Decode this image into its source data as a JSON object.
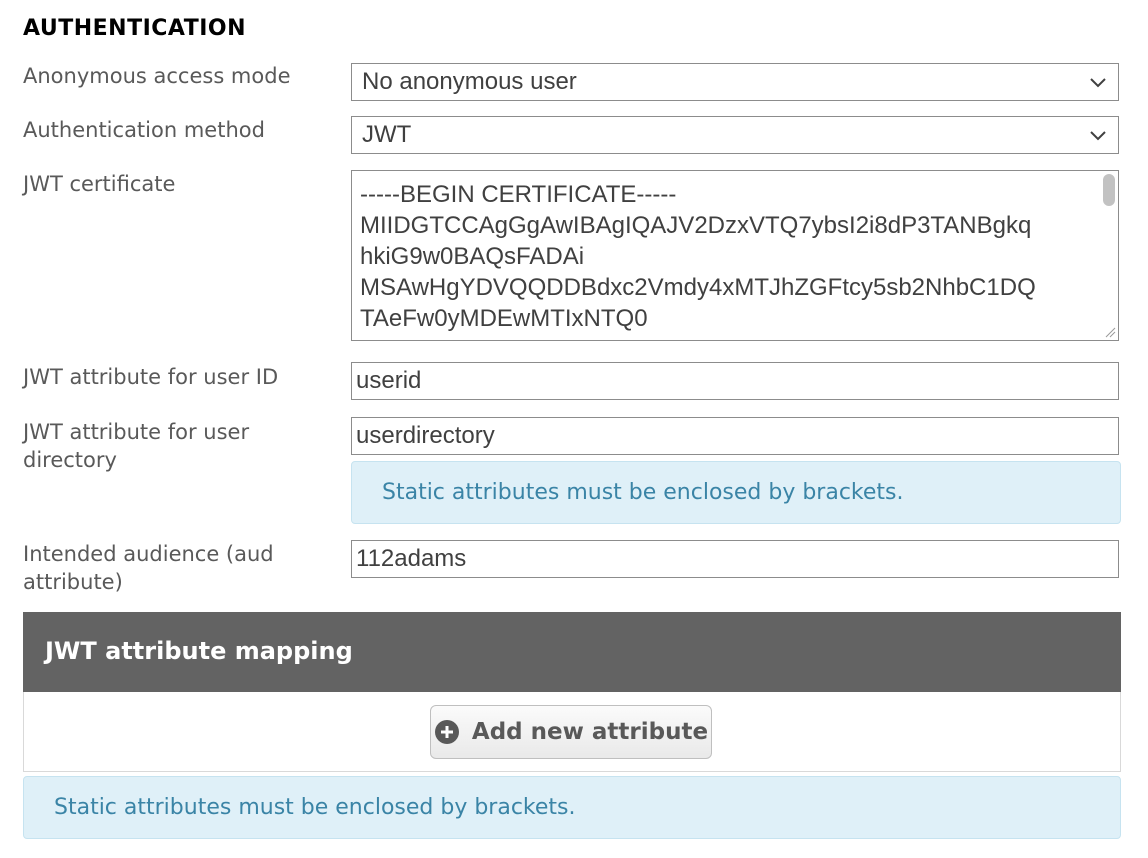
{
  "section": {
    "title": "AUTHENTICATION"
  },
  "anonymous_access": {
    "label": "Anonymous access mode",
    "value": "No anonymous user"
  },
  "auth_method": {
    "label": "Authentication method",
    "value": "JWT"
  },
  "jwt_certificate": {
    "label": "JWT certificate",
    "lines": [
      "-----BEGIN CERTIFICATE-----",
      "MIIDGTCCAgGgAwIBAgIQAJV2DzxVTQ7ybsI2i8dP3TANBgkq",
      "hkiG9w0BAQsFADAi",
      "MSAwHgYDVQQDDBdxc2Vmdy4xMTJhZGFtcy5sb2NhbC1DQ",
      "TAeFw0yMDEwMTIxNTQ0"
    ]
  },
  "user_id_attr": {
    "label": "JWT attribute for user ID",
    "value": "userid"
  },
  "user_dir_attr": {
    "label": "JWT attribute for user directory",
    "value": "userdirectory"
  },
  "info_message": "Static attributes must be enclosed by brackets.",
  "audience": {
    "label": "Intended audience (aud attribute)",
    "value": "112adams"
  },
  "mapping": {
    "title": "JWT attribute mapping",
    "add_button_label": "Add new attribute",
    "info_message": "Static attributes must be enclosed by brackets."
  },
  "colors": {
    "header_bar": "#636363",
    "info_bg": "#dff0f8",
    "info_text": "#3a84a6"
  }
}
